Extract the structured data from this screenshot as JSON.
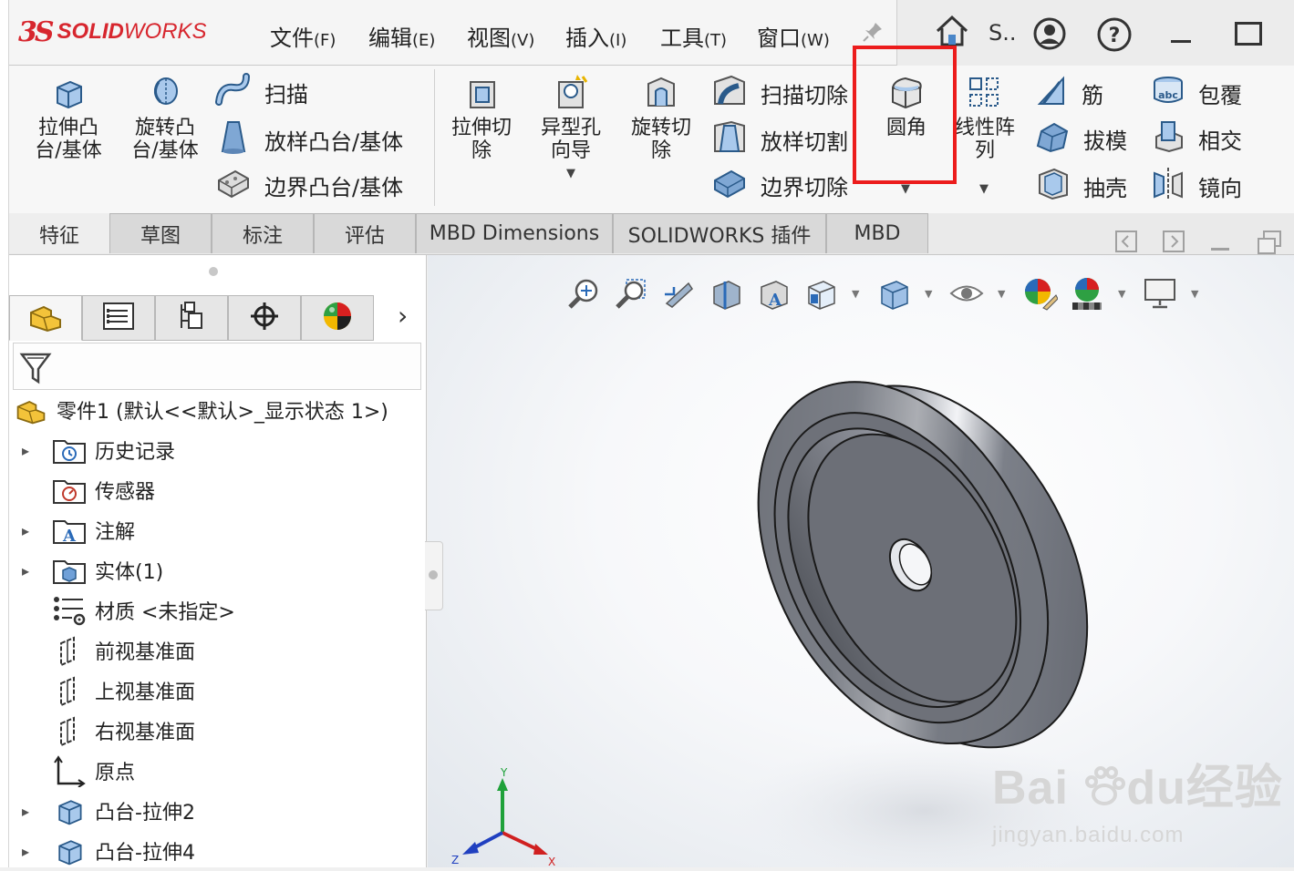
{
  "app": {
    "logo_ds": "3S",
    "logo_solid": "SOLID",
    "logo_works": "WORKS"
  },
  "menu": [
    {
      "label": "文件",
      "key": "(F)"
    },
    {
      "label": "编辑",
      "key": "(E)"
    },
    {
      "label": "视图",
      "key": "(V)"
    },
    {
      "label": "插入",
      "key": "(I)"
    },
    {
      "label": "工具",
      "key": "(T)"
    },
    {
      "label": "窗口",
      "key": "(W)"
    }
  ],
  "search_hint": "S..",
  "ribbon": {
    "extrude_boss": "拉伸凸\n台/基体",
    "revolve_boss": "旋转凸\n台/基体",
    "sweep": "扫描",
    "loft_boss": "放样凸台/基体",
    "boundary_boss": "边界凸台/基体",
    "extrude_cut": "拉伸切\n除",
    "hole_wizard": "异型孔\n向导",
    "revolve_cut": "旋转切\n除",
    "sweep_cut": "扫描切除",
    "loft_cut": "放样切割",
    "boundary_cut": "边界切除",
    "fillet": "圆角",
    "linear_pattern": "线性阵\n列",
    "rib": "筋",
    "draft": "拔模",
    "shell": "抽壳",
    "wrap": "包覆",
    "intersect": "相交",
    "mirror": "镜向"
  },
  "tabs": [
    "特征",
    "草图",
    "标注",
    "评估",
    "MBD Dimensions",
    "SOLIDWORKS 插件",
    "MBD"
  ],
  "tree": {
    "root": "零件1 (默认<<默认>_显示状态 1>)",
    "items": [
      {
        "label": "历史记录",
        "expand": "▸"
      },
      {
        "label": "传感器",
        "expand": ""
      },
      {
        "label": "注解",
        "expand": "▸"
      },
      {
        "label": "实体(1)",
        "expand": "▸"
      },
      {
        "label": "材质 <未指定>",
        "expand": ""
      },
      {
        "label": "前视基准面",
        "expand": ""
      },
      {
        "label": "上视基准面",
        "expand": ""
      },
      {
        "label": "右视基准面",
        "expand": ""
      },
      {
        "label": "原点",
        "expand": ""
      },
      {
        "label": "凸台-拉伸2",
        "expand": "▸"
      },
      {
        "label": "凸台-拉伸4",
        "expand": "▸"
      }
    ]
  },
  "triad": {
    "x": "X",
    "y": "Y",
    "z": "Z"
  },
  "watermark": {
    "brand": "Bai",
    "brand_du": "du",
    "brand_cn": "经验",
    "url": "jingyan.baidu.com"
  },
  "colors": {
    "highlight": "#ec1c1c",
    "brand_red": "#d7262e"
  }
}
